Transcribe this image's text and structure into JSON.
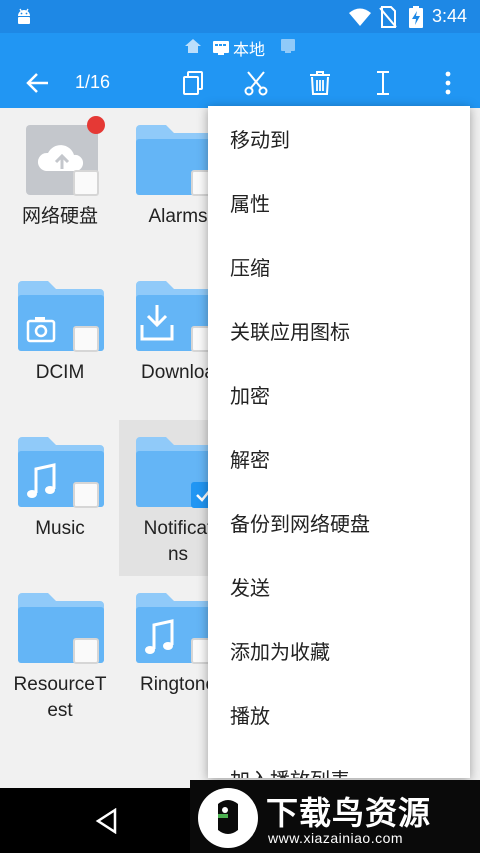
{
  "status_bar": {
    "time": "3:44",
    "icons": [
      "android-icon",
      "wifi-icon",
      "no-sim-icon",
      "battery-charging-icon"
    ]
  },
  "location": {
    "home_icon": "home-icon",
    "label": "本地",
    "phone_icon": "phone-icon"
  },
  "toolbar": {
    "selection_count": "1/16",
    "actions": [
      "copy-icon",
      "cut-icon",
      "delete-icon",
      "rename-icon",
      "more-icon"
    ]
  },
  "files": [
    {
      "label": "网络硬盘",
      "type": "cloud"
    },
    {
      "label": "Alarms",
      "type": "folder"
    },
    {
      "label": "DCIM",
      "type": "folder-camera"
    },
    {
      "label": "Downloa",
      "type": "folder-download"
    },
    {
      "label": "Music",
      "type": "folder-music"
    },
    {
      "label": "Notificat\nns",
      "type": "folder",
      "selected": true
    },
    {
      "label": "ResourceT\nest",
      "type": "folder"
    },
    {
      "label": "Ringtone",
      "type": "folder-music"
    }
  ],
  "menu": {
    "items": [
      {
        "label": "移动到"
      },
      {
        "label": "属性"
      },
      {
        "label": "压缩"
      },
      {
        "label": "关联应用图标"
      },
      {
        "label": "加密"
      },
      {
        "label": "解密"
      },
      {
        "label": "备份到网络硬盘"
      },
      {
        "label": "发送"
      },
      {
        "label": "添加为收藏"
      },
      {
        "label": "播放"
      },
      {
        "label": "加入播放列表"
      }
    ]
  },
  "watermark": {
    "title": "下载鸟资源",
    "url": "www.xiazainiao.com"
  },
  "colors": {
    "primary": "#2196f3",
    "status": "#1e88e5",
    "folder": "#64b5f6",
    "folder_tab": "#90caf9",
    "cloud_box": "#c4c7cc",
    "notification_dot": "#e53935"
  }
}
